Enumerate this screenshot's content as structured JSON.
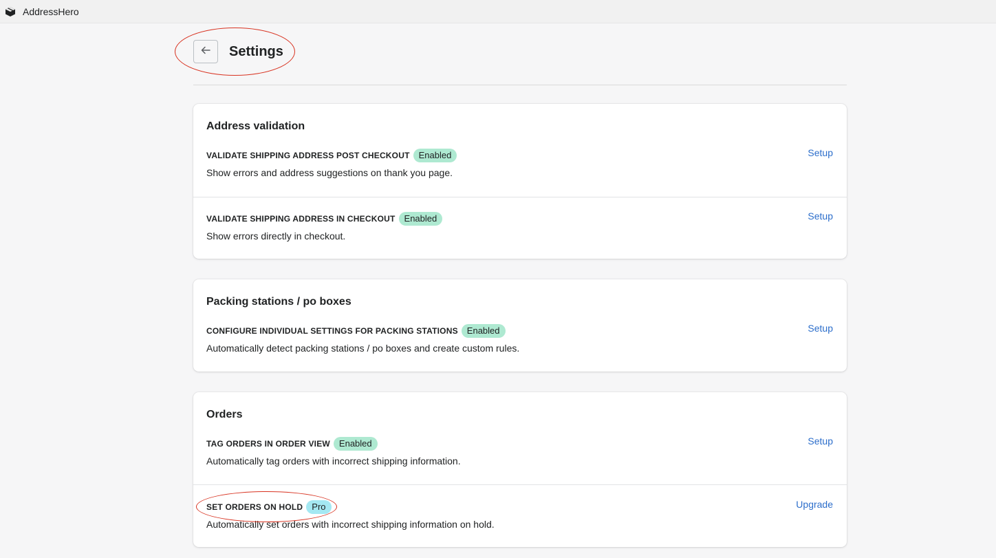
{
  "app": {
    "name": "AddressHero"
  },
  "page": {
    "title": "Settings"
  },
  "colors": {
    "accent": "#2c6ecb",
    "enabled_badge": "#aee9d1",
    "pro_badge": "#a4e8f2",
    "annotation": "#d8311f"
  },
  "cards": [
    {
      "title": "Address validation",
      "rows": [
        {
          "label": "VALIDATE SHIPPING ADDRESS POST CHECKOUT",
          "badge": "Enabled",
          "description": "Show errors and address suggestions on thank you page.",
          "action": "Setup"
        },
        {
          "label": "VALIDATE SHIPPING ADDRESS IN CHECKOUT",
          "badge": "Enabled",
          "description": "Show errors directly in checkout.",
          "action": "Setup"
        }
      ]
    },
    {
      "title": "Packing stations / po boxes",
      "rows": [
        {
          "label": "CONFIGURE INDIVIDUAL SETTINGS FOR PACKING STATIONS",
          "badge": "Enabled",
          "description": "Automatically detect packing stations / po boxes and create custom rules.",
          "action": "Setup"
        }
      ]
    },
    {
      "title": "Orders",
      "rows": [
        {
          "label": "TAG ORDERS IN ORDER VIEW",
          "badge": "Enabled",
          "description": "Automatically tag orders with incorrect shipping information.",
          "action": "Setup"
        },
        {
          "label": "SET ORDERS ON HOLD",
          "badge": "Pro",
          "description": "Automatically set orders with incorrect shipping information on hold.",
          "action": "Upgrade"
        }
      ]
    }
  ]
}
